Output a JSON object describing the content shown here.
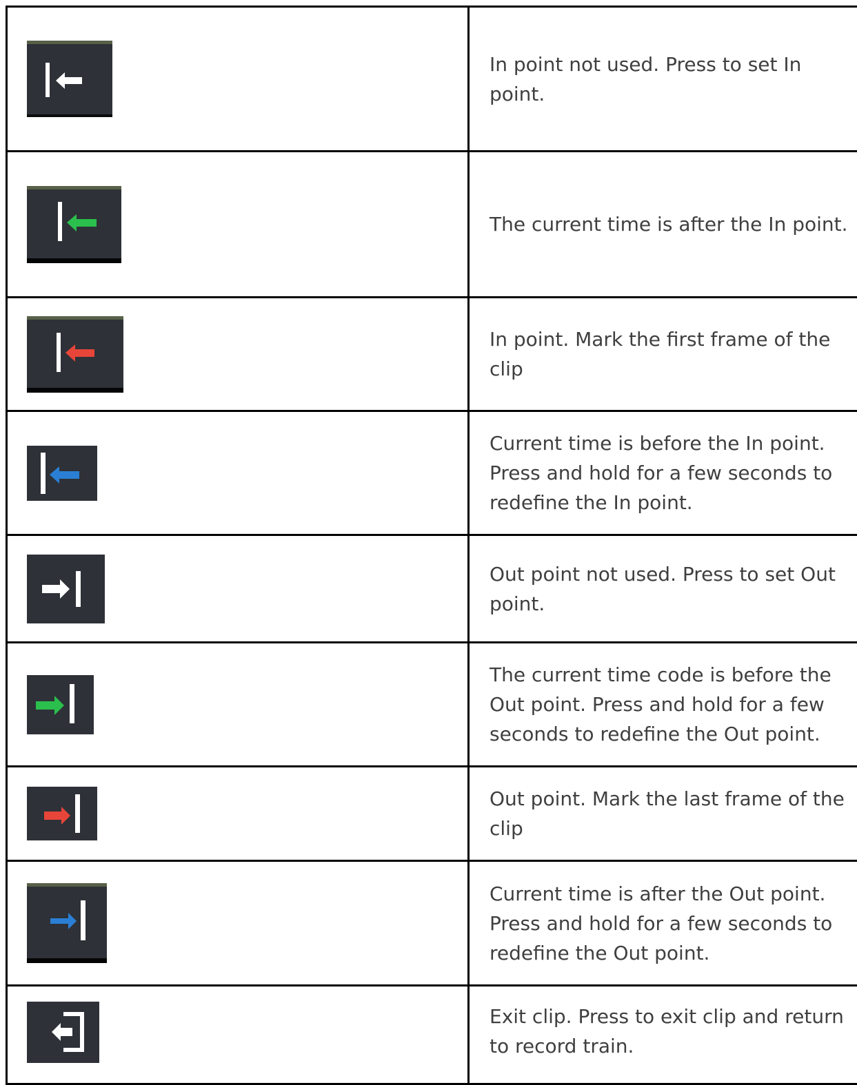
{
  "legend": {
    "rows": [
      {
        "icon": "in-point-unused-icon",
        "arrow_color": "#ffffff",
        "description": "In point not used. Press to set In point."
      },
      {
        "icon": "in-point-after-icon",
        "arrow_color": "#2bbf4d",
        "description": "The current time is after the In point."
      },
      {
        "icon": "in-point-set-icon",
        "arrow_color": "#e8453a",
        "description": "In point. Mark the first frame of the clip"
      },
      {
        "icon": "in-point-before-icon",
        "arrow_color": "#2a7fd4",
        "description": "Current time is before the In point. Press and hold for a few seconds to redefine the In point."
      },
      {
        "icon": "out-point-unused-icon",
        "arrow_color": "#ffffff",
        "description": "Out point not used. Press to set Out point."
      },
      {
        "icon": "out-point-before-icon",
        "arrow_color": "#2bbf4d",
        "description": "The current time code is before the Out point. Press and hold for a few seconds to redefine the Out point."
      },
      {
        "icon": "out-point-set-icon",
        "arrow_color": "#e8453a",
        "description": "Out point. Mark the last frame of the clip"
      },
      {
        "icon": "out-point-after-icon",
        "arrow_color": "#2a7fd4",
        "description": "Current time is after the Out point. Press and hold for a few seconds to redefine the Out point."
      },
      {
        "icon": "exit-clip-icon",
        "arrow_color": "#ffffff",
        "description": "Exit clip. Press to exit clip and return to record train."
      }
    ]
  }
}
